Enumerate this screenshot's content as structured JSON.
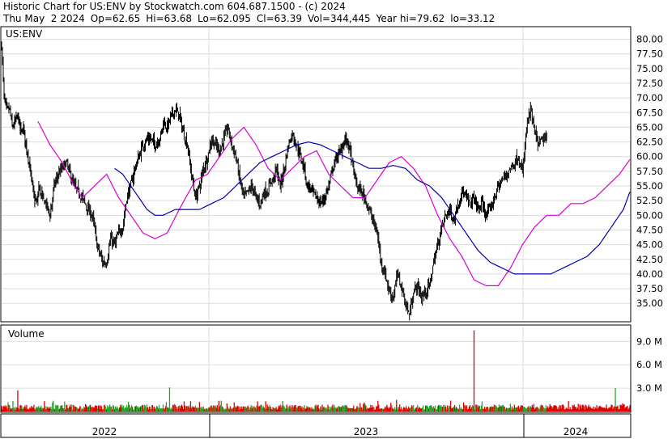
{
  "header": {
    "line1": "Historic Chart for US:ENV by Stockwatch.com 604.687.1500 - (c) 2024",
    "date": "Thu May  2 2024",
    "op": "Op=62.65",
    "hi": "Hi=63.68",
    "lo": "Lo=62.095",
    "cl": "Cl=63.39",
    "vol": "Vol=344,445",
    "yearhi": "Year hi=79.62",
    "yearlo": "lo=33.12"
  },
  "colors": {
    "price": "#000000",
    "ma_short": "#d400d4",
    "ma_long": "#0000b0",
    "vol_up": "#2ea02e",
    "vol_down": "#e00000",
    "grid": "#dcdcdc"
  },
  "chart_data": [
    {
      "type": "line",
      "symbol_label": "US:ENV",
      "subtype": "ohlc",
      "x_labels": [
        "2022",
        "2023",
        "2024"
      ],
      "ylim": [
        32,
        82
      ],
      "y_ticks": [
        "80.00",
        "77.50",
        "75.00",
        "72.50",
        "70.00",
        "67.50",
        "65.00",
        "62.50",
        "60.00",
        "57.50",
        "55.00",
        "52.50",
        "50.00",
        "47.50",
        "45.00",
        "42.50",
        "40.00",
        "37.50",
        "35.00"
      ],
      "y_tick_values": [
        80,
        77.5,
        75,
        72.5,
        70,
        67.5,
        65,
        62.5,
        60,
        57.5,
        55,
        52.5,
        50,
        47.5,
        45,
        42.5,
        40,
        37.5,
        35
      ],
      "price_anchors_x": [
        0,
        3,
        6,
        10,
        13,
        17,
        20,
        24,
        27,
        30,
        33,
        40,
        44,
        46,
        50,
        55,
        60,
        65,
        70,
        75,
        80,
        85,
        90,
        100,
        107,
        112,
        115,
        118,
        125,
        130,
        135,
        140,
        145,
        150,
        155,
        160,
        165,
        170,
        175,
        180,
        185,
        190,
        195,
        198,
        200,
        205,
        210,
        215,
        220,
        225,
        230,
        235,
        240,
        245,
        250,
        255,
        260,
        265,
        270,
        275,
        280,
        285,
        290,
        295,
        300,
        305,
        310,
        315,
        320,
        325,
        330,
        333,
        336,
        340,
        345,
        350,
        355,
        360,
        365,
        370,
        375,
        378,
        380,
        385,
        390,
        395,
        400,
        405,
        410,
        415,
        420,
        425,
        430,
        435,
        440,
        445,
        450,
        455,
        460,
        465,
        470,
        475,
        480,
        485,
        490,
        495,
        500,
        505,
        510,
        515,
        520,
        525,
        530,
        535,
        540,
        545,
        550,
        555,
        560,
        565,
        570,
        575,
        580,
        585,
        590,
        595,
        600,
        605,
        610,
        615,
        620,
        625,
        630,
        635,
        640,
        645,
        650,
        655,
        660,
        665,
        670,
        675,
        680,
        685,
        690,
        695,
        700,
        705,
        710,
        715,
        720,
        725,
        730,
        735,
        740,
        745,
        750,
        755,
        757,
        760,
        765,
        770,
        775,
        778
      ],
      "price_anchors_y": [
        79,
        70,
        68,
        68,
        65,
        66,
        67,
        64,
        65,
        62,
        60,
        53,
        52,
        55,
        53,
        52,
        50,
        55,
        57,
        58,
        59,
        57,
        55,
        53,
        51,
        50,
        48,
        45,
        42,
        42,
        46,
        45,
        47,
        48,
        53,
        55,
        58,
        60,
        62,
        63,
        63,
        62,
        63,
        64,
        66,
        65,
        67,
        68,
        67,
        64,
        62,
        57,
        53,
        55,
        58,
        60,
        63,
        62,
        61,
        63,
        65,
        62,
        60,
        56,
        53,
        54,
        55,
        53,
        52,
        54,
        54,
        56,
        56,
        58,
        55,
        58,
        62,
        64,
        62,
        60,
        58,
        55,
        55,
        54,
        53,
        52,
        53,
        55,
        58,
        60,
        61,
        63,
        62,
        58,
        55,
        54,
        53,
        51,
        49,
        47,
        42,
        40,
        37,
        36,
        40,
        38,
        35,
        33,
        37,
        38,
        36,
        37,
        38,
        42,
        45,
        48,
        50,
        51,
        49,
        52,
        54,
        53,
        52,
        53,
        51,
        52,
        50,
        51,
        53,
        55,
        56,
        57,
        58,
        59,
        60,
        57,
        65,
        68,
        64,
        62,
        63,
        63
      ],
      "ma_short_anchors_x": [
        45,
        60,
        75,
        90,
        100,
        115,
        130,
        145,
        160,
        175,
        190,
        205,
        220,
        240,
        255,
        270,
        285,
        300,
        315,
        330,
        345,
        360,
        375,
        390,
        405,
        420,
        435,
        450,
        465,
        480,
        495,
        510,
        525,
        540,
        555,
        570,
        585,
        600,
        615,
        630,
        645,
        660,
        675,
        690,
        705,
        720,
        735,
        750,
        765,
        778
      ],
      "ma_short_anchors_y": [
        66,
        62,
        59,
        55,
        53,
        55,
        57,
        53,
        50,
        47,
        46,
        47,
        51,
        56,
        57,
        60,
        63,
        65,
        62,
        58,
        56,
        58,
        60,
        61,
        57,
        55,
        53,
        53,
        56,
        59,
        60,
        58,
        55,
        50,
        46,
        43,
        39,
        38,
        38,
        41,
        45,
        48,
        50,
        50,
        52,
        52,
        53,
        55,
        57,
        59.5
      ],
      "ma_long_anchors_x": [
        140,
        150,
        160,
        170,
        180,
        190,
        200,
        215,
        230,
        245,
        260,
        275,
        290,
        305,
        320,
        335,
        350,
        365,
        380,
        395,
        410,
        425,
        440,
        455,
        470,
        485,
        500,
        515,
        530,
        545,
        560,
        575,
        590,
        605,
        620,
        635,
        650,
        665,
        680,
        695,
        710,
        725,
        740,
        755,
        770,
        778
      ],
      "ma_long_anchors_y": [
        58,
        57,
        55,
        53,
        51,
        50,
        50,
        51,
        51,
        51,
        52,
        53,
        55,
        57,
        59,
        60,
        61,
        62,
        62.5,
        62,
        61,
        60,
        59,
        58,
        58,
        58.5,
        58,
        56,
        55,
        53,
        50,
        47,
        44,
        42,
        41,
        40,
        40,
        40,
        40,
        41,
        42,
        43,
        45,
        48,
        51,
        54
      ],
      "note": "Anchor x values are chart column offsets (0 = first bar, 778 = last bar) — data index, not page layout."
    },
    {
      "type": "bar",
      "title": "Volume",
      "y_ticks": [
        "9.0 M",
        "6.0 M",
        "3.0 M"
      ],
      "y_tick_values": [
        9000000,
        6000000,
        3000000
      ],
      "ylim": [
        0,
        11000000
      ],
      "spike_volumes": [
        {
          "index": 585,
          "value": 10400000,
          "dir": "down"
        },
        {
          "index": 208,
          "value": 3100000,
          "dir": "up"
        },
        {
          "index": 760,
          "value": 3000000,
          "dir": "up"
        },
        {
          "index": 20,
          "value": 2700000,
          "dir": "down"
        },
        {
          "index": 489,
          "value": 1500000,
          "dir": "down"
        },
        {
          "index": 595,
          "value": 1300000,
          "dir": "up"
        },
        {
          "index": 630,
          "value": 1000000,
          "dir": "up"
        }
      ],
      "base_volume_range": [
        250000,
        900000
      ]
    }
  ]
}
